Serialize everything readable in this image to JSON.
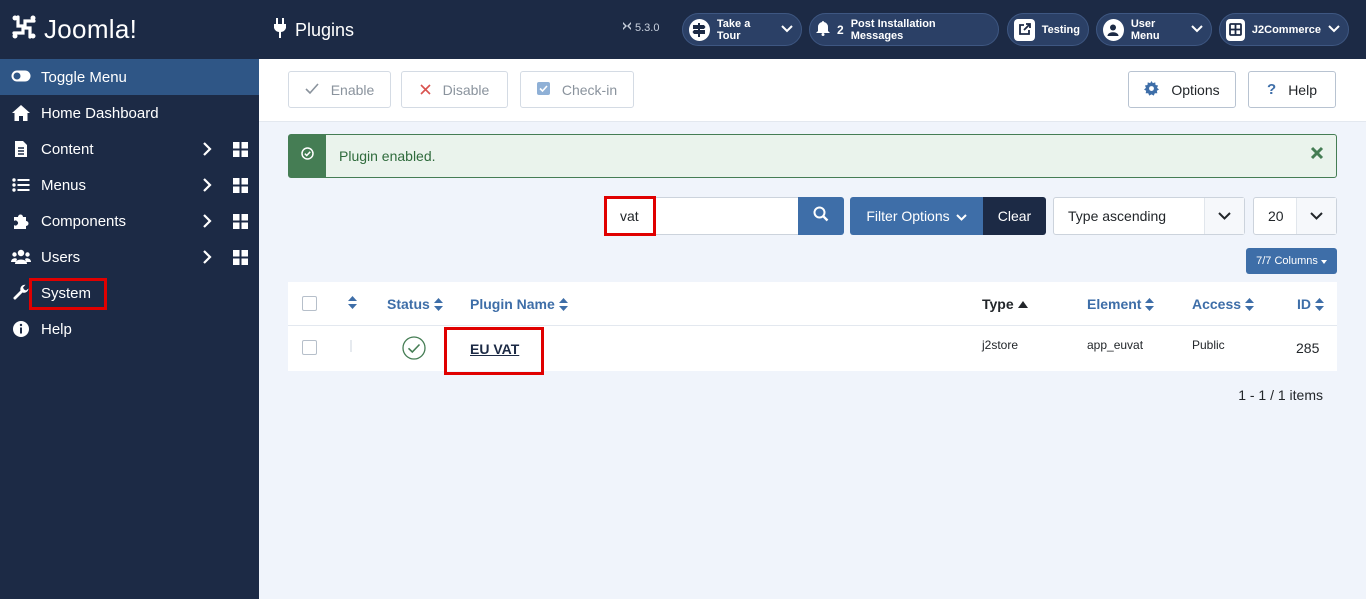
{
  "brand": {
    "name": "Joomla!"
  },
  "sidebar": {
    "toggle_label": "Toggle Menu",
    "items": [
      {
        "label": "Home Dashboard",
        "icon": "home-icon"
      },
      {
        "label": "Content",
        "icon": "file-icon"
      },
      {
        "label": "Menus",
        "icon": "list-icon"
      },
      {
        "label": "Components",
        "icon": "puzzle-icon"
      },
      {
        "label": "Users",
        "icon": "users-icon"
      },
      {
        "label": "System",
        "icon": "wrench-icon"
      },
      {
        "label": "Help",
        "icon": "info-icon"
      }
    ]
  },
  "header": {
    "title": "Plugins",
    "version": "5.3.0",
    "buttons": {
      "tour": "Take a Tour",
      "messages_count": "2",
      "messages": "Post Installation Messages",
      "site": "Testing",
      "user": "User Menu",
      "ext": "J2Commerce"
    }
  },
  "toolbar": {
    "enable": "Enable",
    "disable": "Disable",
    "checkin": "Check-in",
    "options": "Options",
    "help": "Help"
  },
  "alert": {
    "message": "Plugin enabled."
  },
  "filters": {
    "search_value": "vat",
    "filter_options": "Filter Options",
    "clear": "Clear",
    "sort": "Type ascending",
    "limit": "20",
    "columns": "7/7 Columns"
  },
  "table": {
    "headers": {
      "status": "Status",
      "name": "Plugin Name",
      "type": "Type",
      "element": "Element",
      "access": "Access",
      "id": "ID"
    },
    "rows": [
      {
        "name": "EU VAT",
        "type": "j2store",
        "element": "app_euvat",
        "access": "Public",
        "id": "285"
      }
    ]
  },
  "pagination": {
    "text": "1 - 1 / 1 items"
  },
  "colors": {
    "sidebar": "#1c2a45",
    "accent": "#3e6ea8",
    "success": "#457d54",
    "highlight": "#e00000"
  }
}
